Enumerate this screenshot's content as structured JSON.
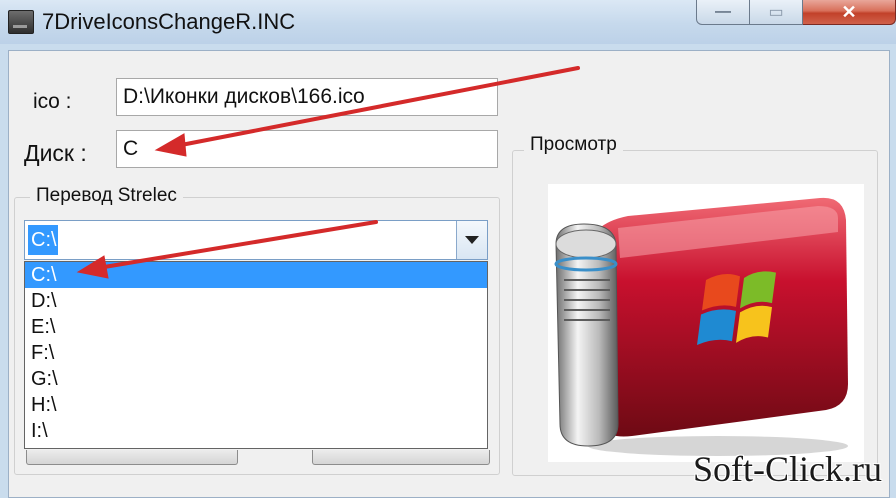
{
  "window": {
    "title": "7DriveIconsChangeR.INC",
    "minimize_icon": "—",
    "maximize_icon": "▭",
    "close_icon": "✕"
  },
  "form": {
    "ico_label": "ico :",
    "ico_value": "D:\\Иконки дисков\\166.ico",
    "disk_label": "Диск :",
    "disk_value": "C"
  },
  "group": {
    "title": "Перевод Strelec",
    "combo_value": "C:\\",
    "options": [
      "C:\\",
      "D:\\",
      "E:\\",
      "F:\\",
      "G:\\",
      "H:\\",
      "I:\\"
    ],
    "selected_index": 0
  },
  "preview": {
    "title": "Просмотр",
    "image_icon": "red-external-drive-windows-icon"
  },
  "watermark": "Soft-Click.ru",
  "colors": {
    "selection": "#3399ff",
    "annotation_arrow": "#d42a2a",
    "drive_red": "#c8102e"
  }
}
